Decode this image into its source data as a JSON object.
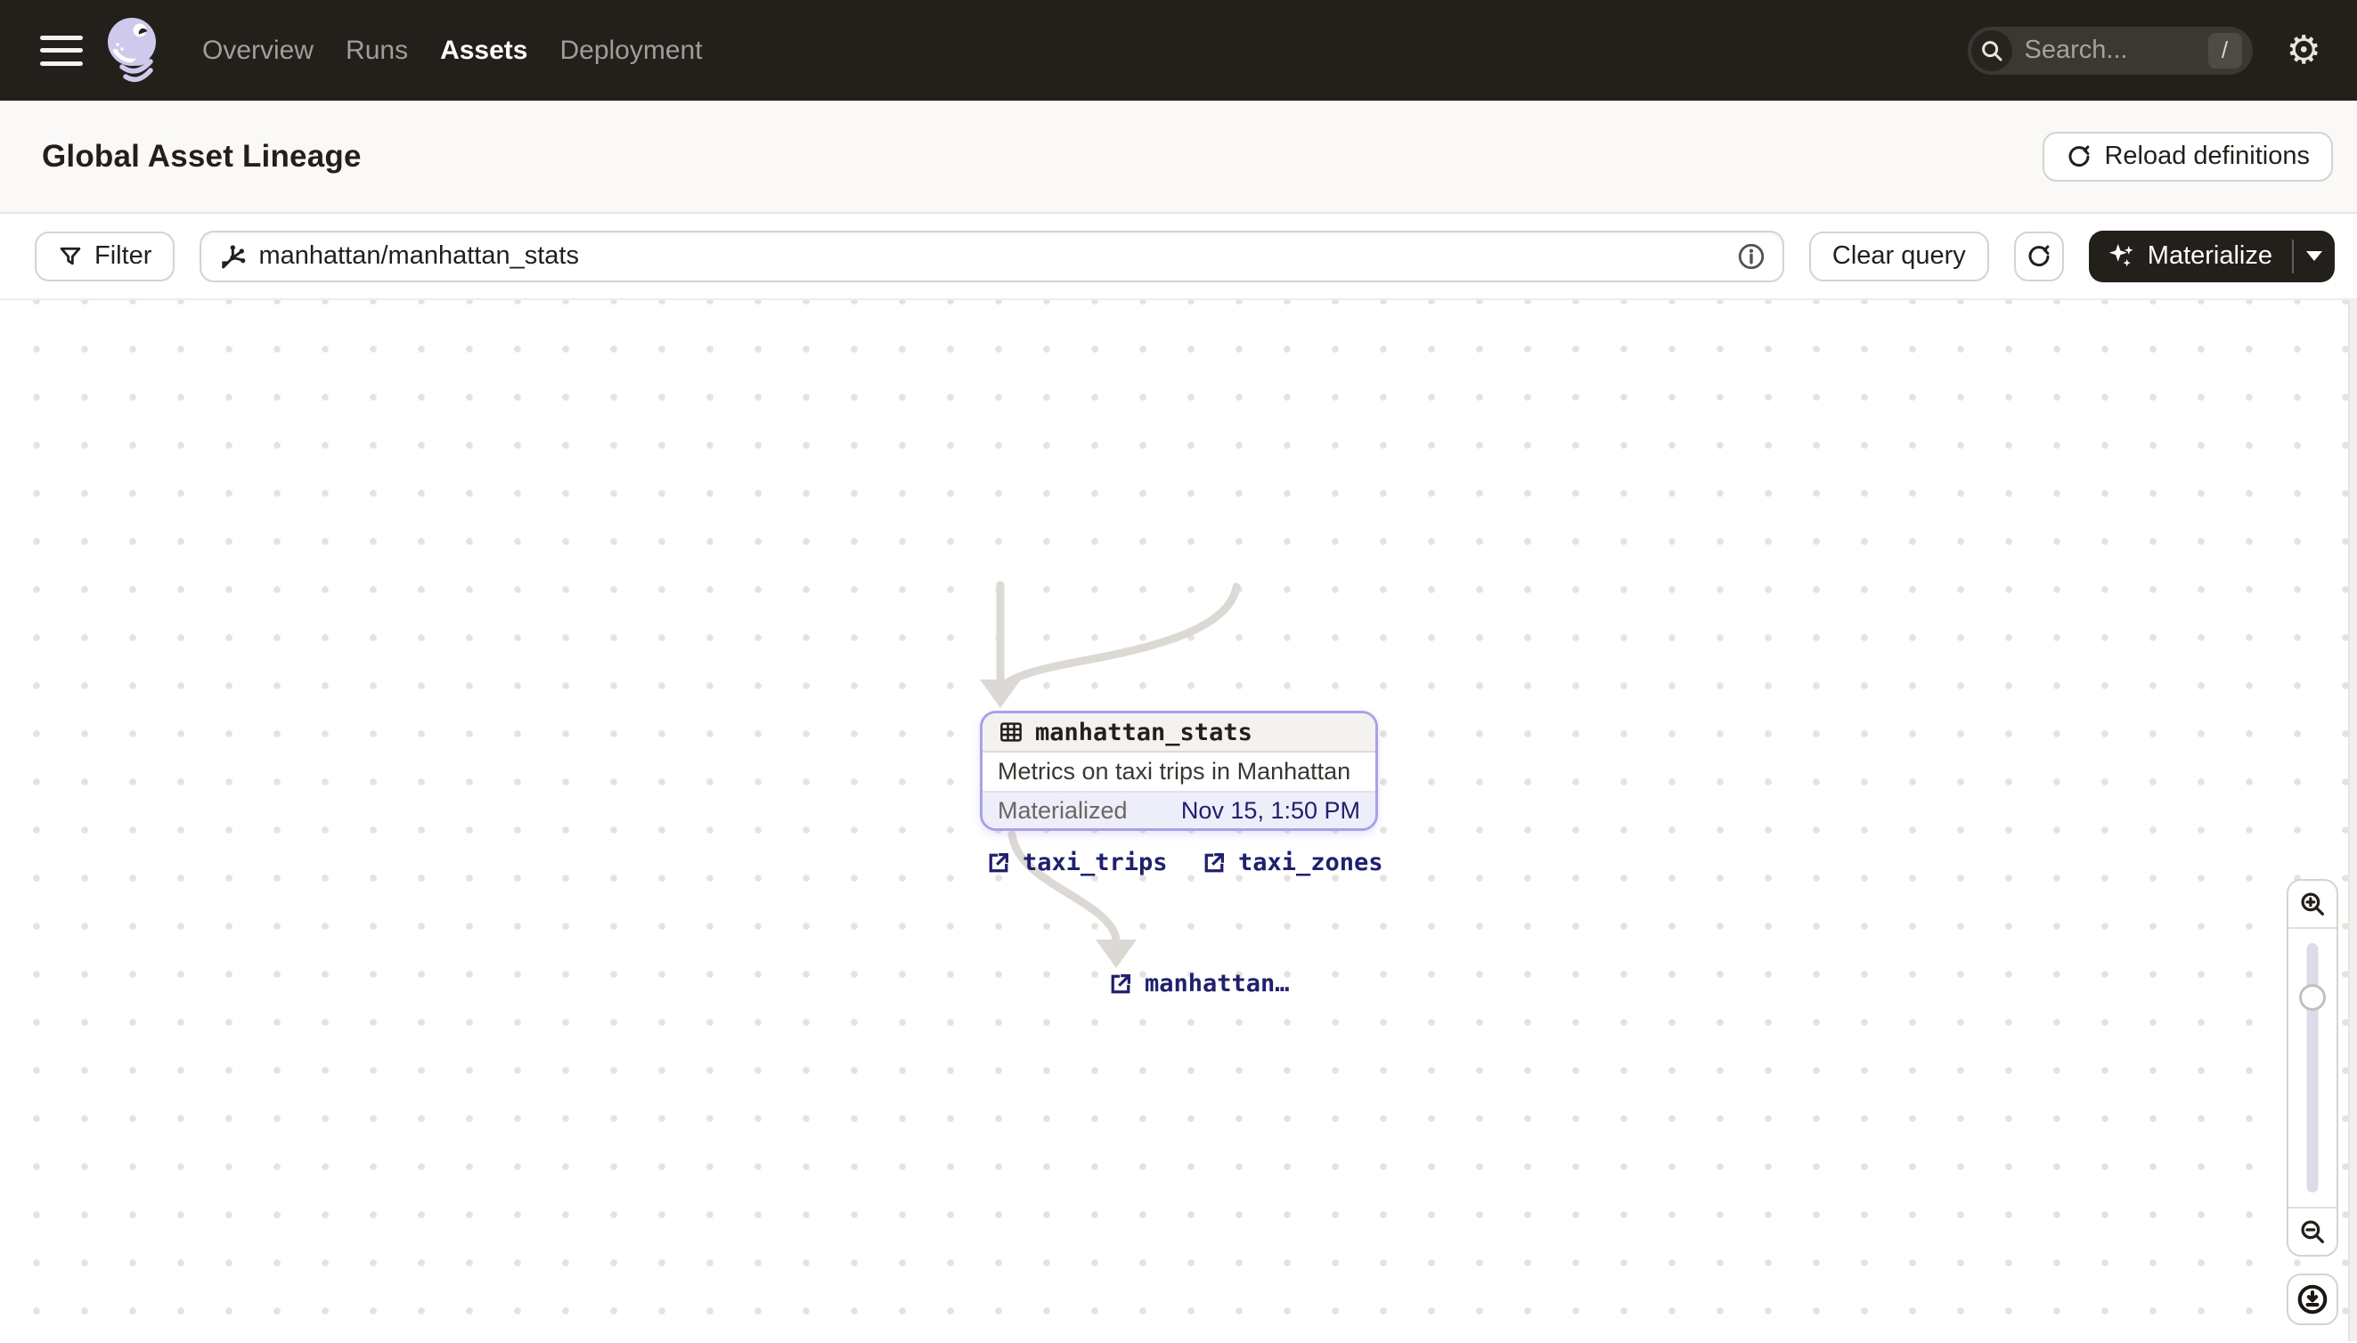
{
  "nav": {
    "menu": [
      {
        "label": "Overview",
        "active": false
      },
      {
        "label": "Runs",
        "active": false
      },
      {
        "label": "Assets",
        "active": true
      },
      {
        "label": "Deployment",
        "active": false
      }
    ],
    "search_placeholder": "Search...",
    "search_shortcut": "/"
  },
  "header": {
    "title": "Global Asset Lineage",
    "reload_button": "Reload definitions"
  },
  "toolbar": {
    "filter_button": "Filter",
    "query_value": "manhattan/manhattan_stats",
    "clear_button": "Clear query",
    "materialize_button": "Materialize"
  },
  "graph": {
    "upstream_assets": [
      {
        "label": "taxi_trips"
      },
      {
        "label": "taxi_zones"
      }
    ],
    "selected_asset": {
      "name": "manhattan_stats",
      "description": "Metrics on taxi trips in Manhattan",
      "status_label": "Materialized",
      "materialized_at": "Nov 15, 1:50 PM"
    },
    "downstream_assets": [
      {
        "label": "manhattan…"
      }
    ]
  },
  "icons": {
    "gear": "⚙",
    "names": [
      "menu-icon",
      "dagster-logo",
      "search-icon",
      "gear-icon",
      "reload-icon",
      "filter-icon",
      "asset-graph-icon",
      "info-icon",
      "refresh-icon",
      "sparkle-icon",
      "caret-down-icon",
      "external-link-icon",
      "table-icon",
      "zoom-in-icon",
      "zoom-out-icon",
      "download-icon"
    ]
  },
  "colors": {
    "nav_dark": "#231f1b",
    "accent_lavender": "#a9a1ea",
    "link_navy": "#20206e",
    "edge_gray": "#dcd8d4"
  }
}
